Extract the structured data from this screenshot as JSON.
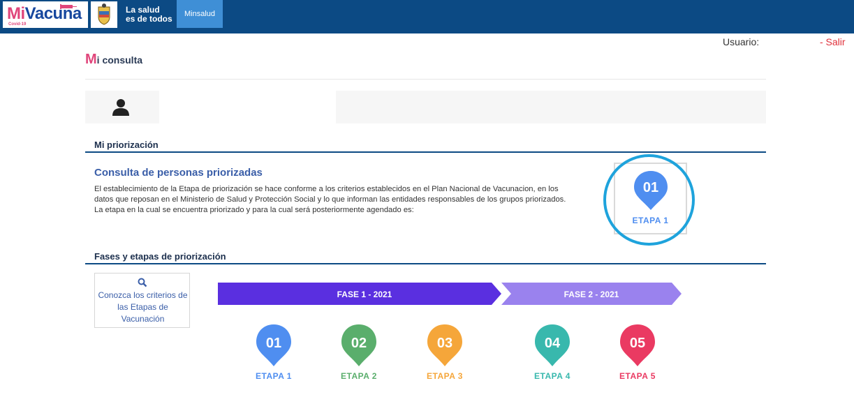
{
  "header": {
    "logo_mi": "Mi",
    "logo_vacuna": "Vacuna",
    "logo_sub": "Covid-19",
    "salud_line1": "La salud",
    "salud_line2": "es de todos",
    "minsalud": "Minsalud"
  },
  "user": {
    "label": "Usuario:",
    "logout": "- Salir"
  },
  "page": {
    "title_initial": "M",
    "title_rest": "i consulta"
  },
  "priorizacion": {
    "section_title": "Mi priorización",
    "heading": "Consulta de personas priorizadas",
    "line1": "El establecimiento de la Etapa de priorización se hace conforme a los criterios establecidos en el Plan Nacional de Vacunacion, en los",
    "line2": "datos que reposan en el Ministerio de Salud y Protección Social y lo que informan las entidades responsables de los grupos priorizados.",
    "line3": "La etapa en la cual se encuentra priorizado y para la cual será posteriormente agendado es:",
    "current_number": "01",
    "current_label": "ETAPA 1",
    "current_color": "#4f8ef0"
  },
  "fases": {
    "section_title": "Fases y etapas de priorización",
    "criterios_link": "Conozca los criterios de las Etapas de Vacunación",
    "fase1": "FASE 1 - 2021",
    "fase2": "FASE 2 - 2021",
    "fase1_color": "#5a2fe0",
    "fase2_color": "#9a82ee",
    "etapas": [
      {
        "number": "01",
        "label": "ETAPA 1",
        "color": "#4f8ef0"
      },
      {
        "number": "02",
        "label": "ETAPA 2",
        "color": "#5aae6c"
      },
      {
        "number": "03",
        "label": "ETAPA 3",
        "color": "#f5a63a"
      },
      {
        "number": "04",
        "label": "ETAPA 4",
        "color": "#38b8ad"
      },
      {
        "number": "05",
        "label": "ETAPA 5",
        "color": "#ea3a62"
      }
    ]
  }
}
